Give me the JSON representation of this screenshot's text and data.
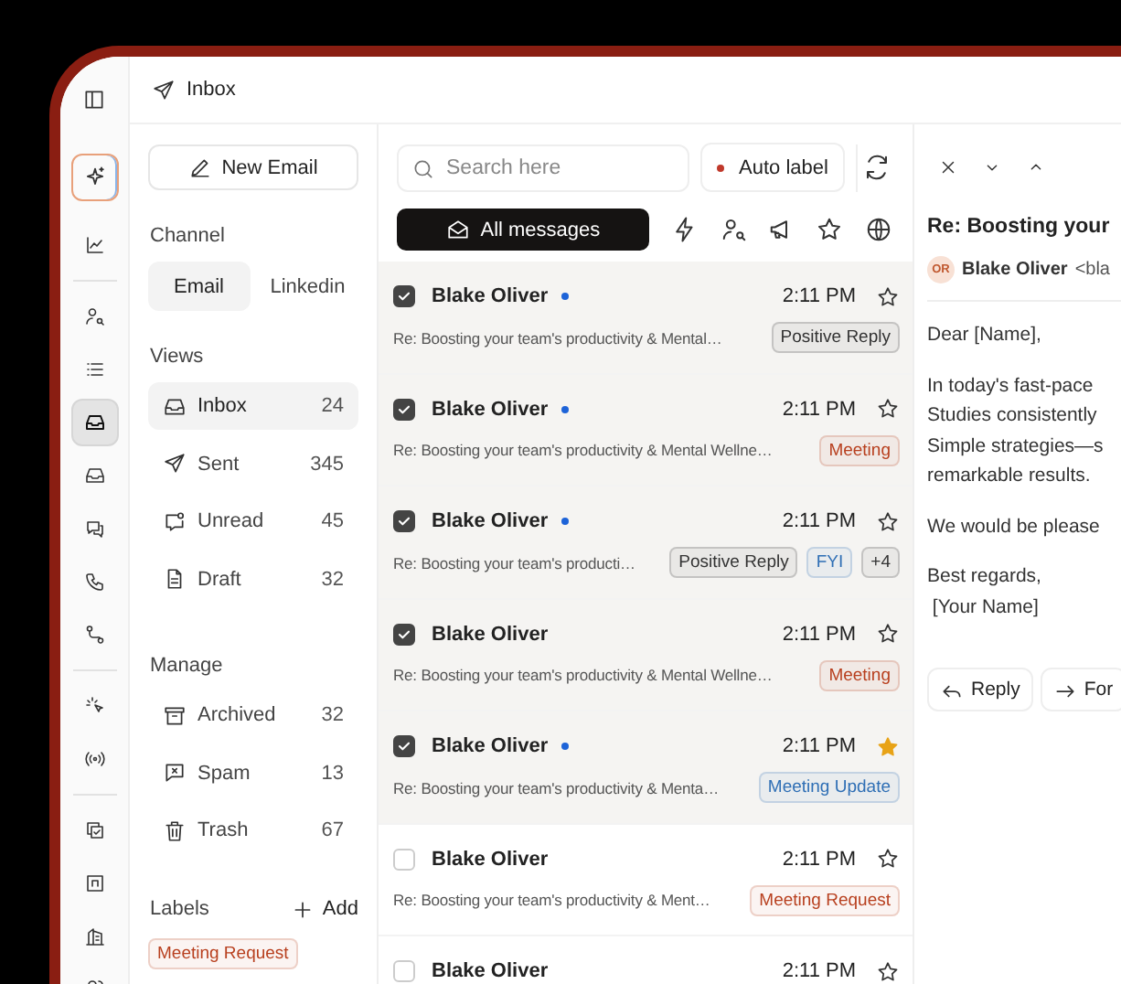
{
  "header": {
    "title": "Inbox"
  },
  "rail_groups": [
    {
      "items": [
        {
          "selected": false
        },
        {
          "selected": false
        }
      ]
    },
    {
      "items": [
        {
          "selected": false
        },
        {
          "selected": false
        },
        {
          "selected": true
        },
        {
          "selected": false
        },
        {
          "selected": false
        },
        {
          "selected": false
        },
        {
          "selected": false
        }
      ]
    },
    {
      "items": [
        {
          "selected": false
        },
        {
          "selected": false
        }
      ]
    },
    {
      "items": [
        {
          "selected": false
        },
        {
          "selected": false
        },
        {
          "selected": false
        },
        {
          "selected": false
        }
      ]
    }
  ],
  "new_email": "New Email",
  "channel": {
    "heading": "Channel",
    "tabs": [
      {
        "label": "Email",
        "selected": true
      },
      {
        "label": "Linkedin",
        "selected": false
      }
    ]
  },
  "views": {
    "heading": "Views",
    "items": [
      {
        "label": "Inbox",
        "count": "24",
        "selected": true
      },
      {
        "label": "Sent",
        "count": "345",
        "selected": false
      },
      {
        "label": "Unread",
        "count": "45",
        "selected": false
      },
      {
        "label": "Draft",
        "count": "32",
        "selected": false
      }
    ]
  },
  "manage": {
    "heading": "Manage",
    "items": [
      {
        "label": "Archived",
        "count": "32",
        "selected": false
      },
      {
        "label": "Spam",
        "count": "13",
        "selected": false
      },
      {
        "label": "Trash",
        "count": "67",
        "selected": false
      }
    ]
  },
  "labels": {
    "heading": "Labels",
    "add": "Add",
    "items": [
      {
        "label": "Meeting Request",
        "color": "#b8401f"
      }
    ]
  },
  "search": {
    "placeholder": "Search here"
  },
  "auto_label": "Auto label",
  "filters": [
    {
      "label": "All messages",
      "selected": true
    },
    {
      "selected": false
    },
    {
      "selected": false
    },
    {
      "selected": false
    },
    {
      "selected": false
    },
    {
      "selected": false
    }
  ],
  "messages": [
    {
      "sender": "Blake Oliver",
      "unread": true,
      "time": "2:11 PM",
      "starred": false,
      "checked": true,
      "subject": "Re: Boosting your team's productivity & Mental…",
      "tags": [
        {
          "label": "Positive Reply",
          "color": "#333333"
        }
      ]
    },
    {
      "sender": "Blake Oliver",
      "unread": true,
      "time": "2:11 PM",
      "starred": false,
      "checked": true,
      "subject": "Re: Boosting your team's productivity & Mental Wellne…",
      "tags": [
        {
          "label": "Meeting",
          "color": "#b8401f"
        }
      ]
    },
    {
      "sender": "Blake Oliver",
      "unread": true,
      "time": "2:11 PM",
      "starred": false,
      "checked": true,
      "subject": "Re: Boosting your team's producti…",
      "tags": [
        {
          "label": "Positive Reply",
          "color": "#333333"
        },
        {
          "label": "FYI",
          "color": "#2f6fb5"
        },
        {
          "label": "+4",
          "color": "#333333"
        }
      ]
    },
    {
      "sender": "Blake Oliver",
      "unread": false,
      "time": "2:11 PM",
      "starred": false,
      "checked": true,
      "subject": "Re: Boosting your team's productivity & Mental Wellne…",
      "tags": [
        {
          "label": "Meeting",
          "color": "#b8401f"
        }
      ]
    },
    {
      "sender": "Blake Oliver",
      "unread": true,
      "time": "2:11 PM",
      "starred": true,
      "checked": true,
      "subject": "Re: Boosting your team's productivity & Menta…",
      "tags": [
        {
          "label": "Meeting Update",
          "color": "#2f6fb5"
        }
      ]
    },
    {
      "sender": "Blake Oliver",
      "unread": false,
      "time": "2:11 PM",
      "starred": false,
      "checked": false,
      "subject": "Re: Boosting your team's productivity & Ment…",
      "tags": [
        {
          "label": "Meeting Request",
          "color": "#b8401f"
        }
      ]
    },
    {
      "sender": "Blake Oliver",
      "unread": false,
      "time": "2:11 PM",
      "starred": false,
      "checked": false
    }
  ],
  "detail": {
    "title": "Re: Boosting your",
    "avatar": "OR",
    "sender": "Blake Oliver",
    "email": "<bla",
    "body": [
      "Dear [Name],",
      "In today's fast-pace\nStudies consistently\nSimple strategies—s\nremarkable results.",
      "We would be please",
      "Best regards,\n [Your Name]"
    ],
    "buttons": [
      "Reply",
      "For"
    ]
  }
}
